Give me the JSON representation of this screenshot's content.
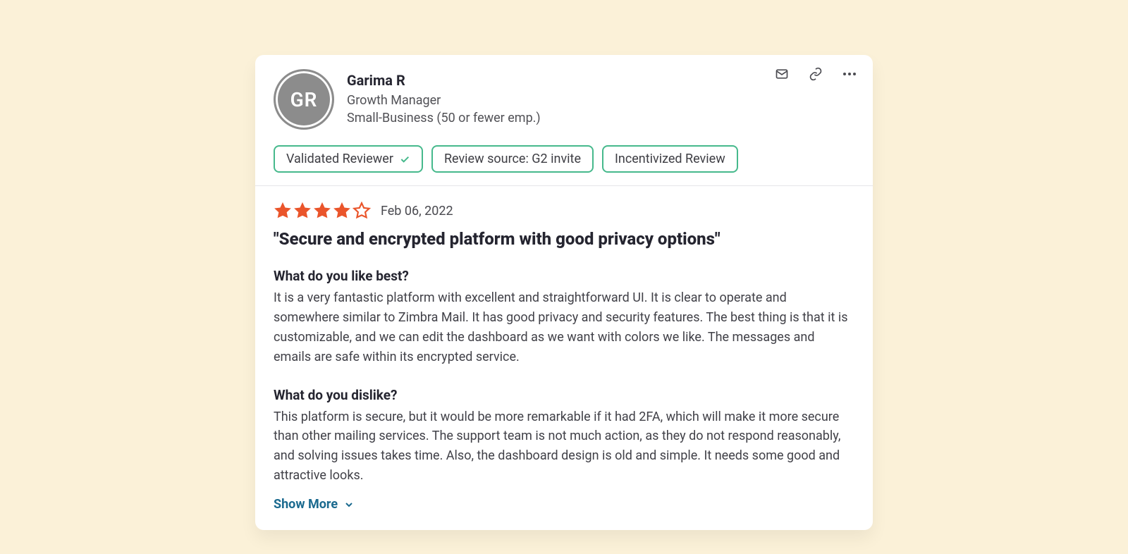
{
  "reviewer": {
    "initials": "GR",
    "name": "Garima R",
    "job_title": "Growth Manager",
    "company_size": "Small-Business (50 or fewer emp.)"
  },
  "actions": {
    "email_icon": "mail-icon",
    "link_icon": "link-icon",
    "more_icon": "more-icon"
  },
  "badges": [
    {
      "label": "Validated Reviewer",
      "has_check": true
    },
    {
      "label": "Review source: G2 invite",
      "has_check": false
    },
    {
      "label": "Incentivized Review",
      "has_check": false
    }
  ],
  "rating": {
    "value": 4,
    "out_of": 5
  },
  "date": "Feb 06, 2022",
  "review_title": "\"Secure and encrypted platform with good privacy options\"",
  "sections": {
    "like_q": "What do you like best?",
    "like_a": "It is a very fantastic platform with excellent and straightforward UI. It is clear to operate and somewhere similar to Zimbra Mail. It has good privacy and security features. The best thing is that it is customizable, and we can edit the dashboard as we want with colors we like. The messages and emails are safe within its encrypted service.",
    "dislike_q": "What do you dislike?",
    "dislike_a": "This platform is secure, but it would be more remarkable if it had 2FA, which will make it more secure than other mailing services. The support team is not much action, as they do not respond reasonably, and solving issues takes time. Also, the dashboard design is old and simple. It needs some good and attractive looks."
  },
  "show_more_label": "Show More",
  "colors": {
    "page_bg": "#fbf1d8",
    "star": "#ea552b",
    "badge_border": "#46b98c",
    "link": "#1b6a8f"
  }
}
